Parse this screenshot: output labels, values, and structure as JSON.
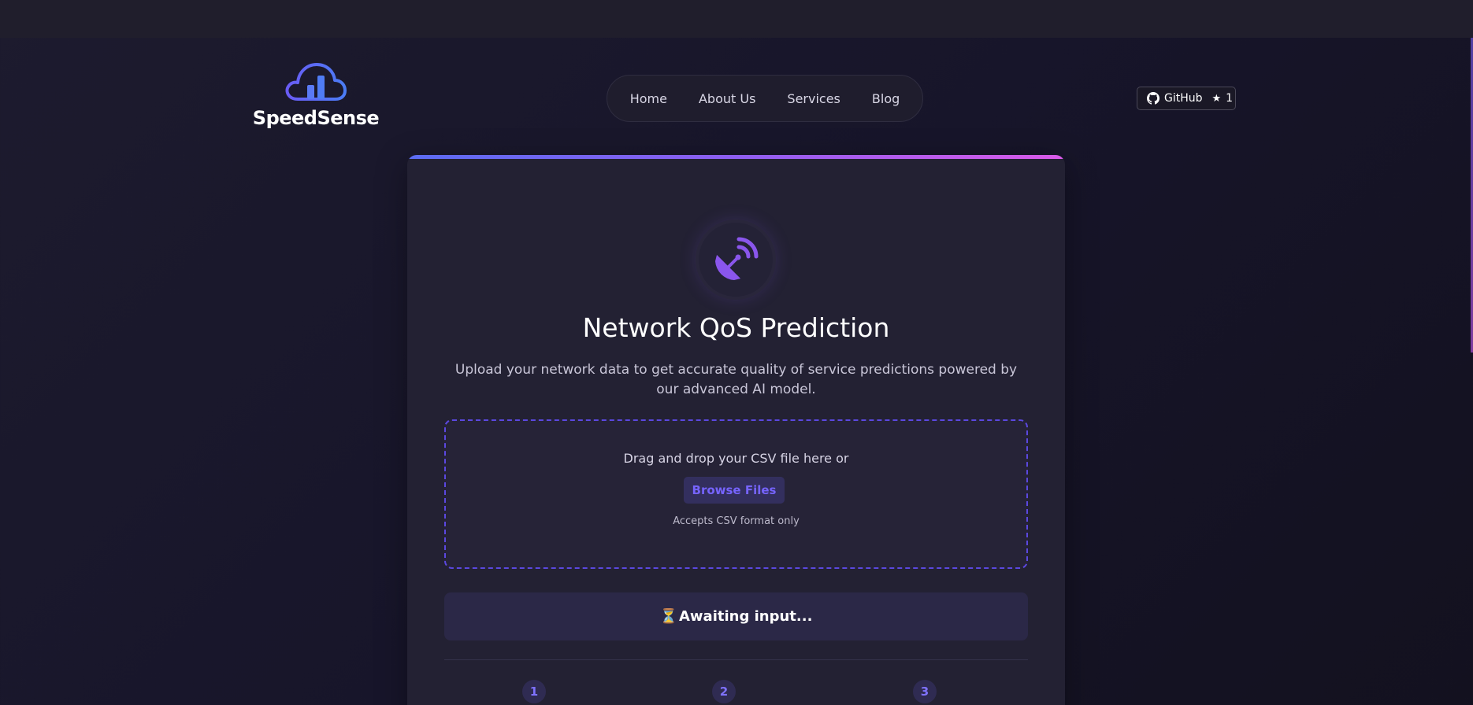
{
  "brand": {
    "name": "SpeedSense",
    "colors": {
      "accent": "#7b5cf5",
      "accent_blue": "#4f6cf5",
      "accent_pink": "#d95ae8"
    }
  },
  "nav": {
    "items": [
      {
        "label": "Home"
      },
      {
        "label": "About Us"
      },
      {
        "label": "Services"
      },
      {
        "label": "Blog"
      }
    ]
  },
  "github": {
    "label": "GitHub",
    "stars": "1",
    "icon": "github-icon",
    "star_icon": "star-icon"
  },
  "main": {
    "icon": "satellite-dish-icon",
    "title": "Network QoS Prediction",
    "subtitle": "Upload your network data to get accurate quality of service predictions powered by our advanced AI model.",
    "upload": {
      "prompt": "Drag and drop your CSV file here or",
      "button_label": "Browse Files",
      "note": "Accepts CSV format only"
    },
    "status": {
      "icon": "hourglass-icon",
      "text": "Awaiting input..."
    },
    "steps": [
      "1",
      "2",
      "3"
    ]
  }
}
